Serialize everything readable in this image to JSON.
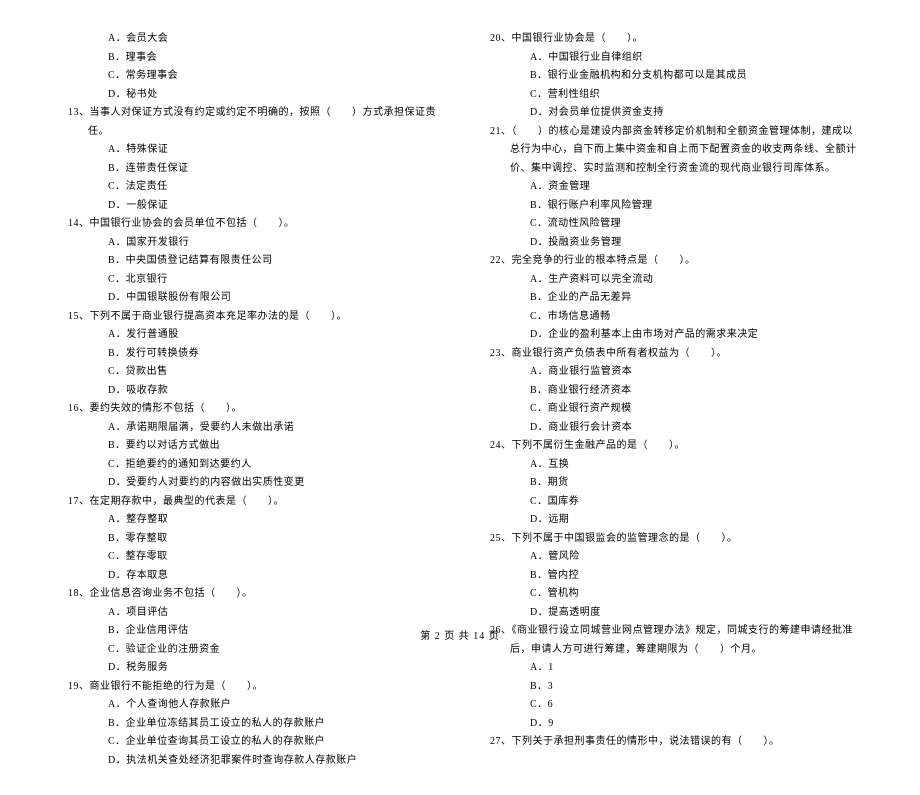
{
  "left_column": [
    {
      "type": "option",
      "text": "A．会员大会"
    },
    {
      "type": "option",
      "text": "B．理事会"
    },
    {
      "type": "option",
      "text": "C．常务理事会"
    },
    {
      "type": "option",
      "text": "D．秘书处"
    },
    {
      "type": "question",
      "text": "13、当事人对保证方式没有约定或约定不明确的，按照（　　）方式承担保证责任。"
    },
    {
      "type": "option",
      "text": "A．特殊保证"
    },
    {
      "type": "option",
      "text": "B．连带责任保证"
    },
    {
      "type": "option",
      "text": "C．法定责任"
    },
    {
      "type": "option",
      "text": "D．一般保证"
    },
    {
      "type": "question",
      "text": "14、中国银行业协会的会员单位不包括（　　）。"
    },
    {
      "type": "option",
      "text": "A．国家开发银行"
    },
    {
      "type": "option",
      "text": "B．中央国债登记结算有限责任公司"
    },
    {
      "type": "option",
      "text": "C．北京银行"
    },
    {
      "type": "option",
      "text": "D．中国银联股份有限公司"
    },
    {
      "type": "question",
      "text": "15、下列不属于商业银行提高资本充足率办法的是（　　）。"
    },
    {
      "type": "option",
      "text": "A．发行普通股"
    },
    {
      "type": "option",
      "text": "B．发行可转换债券"
    },
    {
      "type": "option",
      "text": "C．贷款出售"
    },
    {
      "type": "option",
      "text": "D．吸收存款"
    },
    {
      "type": "question",
      "text": "16、要约失效的情形不包括（　　）。"
    },
    {
      "type": "option",
      "text": "A．承诺期限届满，受要约人未做出承诺"
    },
    {
      "type": "option",
      "text": "B．要约以对话方式做出"
    },
    {
      "type": "option",
      "text": "C．拒绝要约的通知到达要约人"
    },
    {
      "type": "option",
      "text": "D．受要约人对要约的内容做出实质性变更"
    },
    {
      "type": "question",
      "text": "17、在定期存款中，最典型的代表是（　　）。"
    },
    {
      "type": "option",
      "text": "A．整存整取"
    },
    {
      "type": "option",
      "text": "B．零存整取"
    },
    {
      "type": "option",
      "text": "C．整存零取"
    },
    {
      "type": "option",
      "text": "D．存本取息"
    },
    {
      "type": "question",
      "text": "18、企业信息咨询业务不包括（　　）。"
    },
    {
      "type": "option",
      "text": "A．项目评估"
    },
    {
      "type": "option",
      "text": "B．企业信用评估"
    },
    {
      "type": "option",
      "text": "C．验证企业的注册资金"
    },
    {
      "type": "option",
      "text": "D．税务服务"
    },
    {
      "type": "question",
      "text": "19、商业银行不能拒绝的行为是（　　）。"
    },
    {
      "type": "option",
      "text": "A．个人查询他人存款账户"
    },
    {
      "type": "option",
      "text": "B．企业单位冻结其员工设立的私人的存款账户"
    },
    {
      "type": "option",
      "text": "C．企业单位查询其员工设立的私人的存款账户"
    },
    {
      "type": "option",
      "text": "D．执法机关查处经济犯罪案件时查询存款人存款账户"
    }
  ],
  "right_column": [
    {
      "type": "question",
      "text": "20、中国银行业协会是（　　）。"
    },
    {
      "type": "option",
      "text": "A．中国银行业自律组织"
    },
    {
      "type": "option",
      "text": "B．银行业金融机构和分支机构都可以是其成员"
    },
    {
      "type": "option",
      "text": "C．营利性组织"
    },
    {
      "type": "option",
      "text": "D．对会员单位提供资金支持"
    },
    {
      "type": "question",
      "text": "21、（　　）的核心是建设内部资金转移定价机制和全额资金管理体制，建成以总行为中心，自下而上集中资金和自上而下配置资金的收支两条线、全额计价、集中调控、实时监测和控制全行资金流的现代商业银行司库体系。"
    },
    {
      "type": "option",
      "text": "A．资金管理"
    },
    {
      "type": "option",
      "text": "B．银行账户利率风险管理"
    },
    {
      "type": "option",
      "text": "C．流动性风险管理"
    },
    {
      "type": "option",
      "text": "D．投融资业务管理"
    },
    {
      "type": "question",
      "text": "22、完全竞争的行业的根本特点是（　　）。"
    },
    {
      "type": "option",
      "text": "A．生产资料可以完全流动"
    },
    {
      "type": "option",
      "text": "B．企业的产品无差异"
    },
    {
      "type": "option",
      "text": "C．市场信息通畅"
    },
    {
      "type": "option",
      "text": "D．企业的盈利基本上由市场对产品的需求来决定"
    },
    {
      "type": "question",
      "text": "23、商业银行资产负债表中所有者权益为（　　）。"
    },
    {
      "type": "option",
      "text": "A．商业银行监管资本"
    },
    {
      "type": "option",
      "text": "B．商业银行经济资本"
    },
    {
      "type": "option",
      "text": "C．商业银行资产规模"
    },
    {
      "type": "option",
      "text": "D．商业银行会计资本"
    },
    {
      "type": "question",
      "text": "24、下列不属衍生金融产品的是（　　）。"
    },
    {
      "type": "option",
      "text": "A．互换"
    },
    {
      "type": "option",
      "text": "B．期货"
    },
    {
      "type": "option",
      "text": "C．国库券"
    },
    {
      "type": "option",
      "text": "D．远期"
    },
    {
      "type": "question",
      "text": "25、下列不属于中国银监会的监管理念的是（　　）。"
    },
    {
      "type": "option",
      "text": "A．管风险"
    },
    {
      "type": "option",
      "text": "B．管内控"
    },
    {
      "type": "option",
      "text": "C．管机构"
    },
    {
      "type": "option",
      "text": "D．提高透明度"
    },
    {
      "type": "question",
      "text": "26、《商业银行设立同城营业网点管理办法》规定，同城支行的筹建申请经批准后，申请人方可进行筹建，筹建期限为（　　）个月。"
    },
    {
      "type": "option",
      "text": "A．1"
    },
    {
      "type": "option",
      "text": "B．3"
    },
    {
      "type": "option",
      "text": "C．6"
    },
    {
      "type": "option",
      "text": "D．9"
    },
    {
      "type": "question",
      "text": "27、下列关于承担刑事责任的情形中，说法错误的有（　　）。"
    }
  ],
  "footer": "第 2 页 共 14 页"
}
